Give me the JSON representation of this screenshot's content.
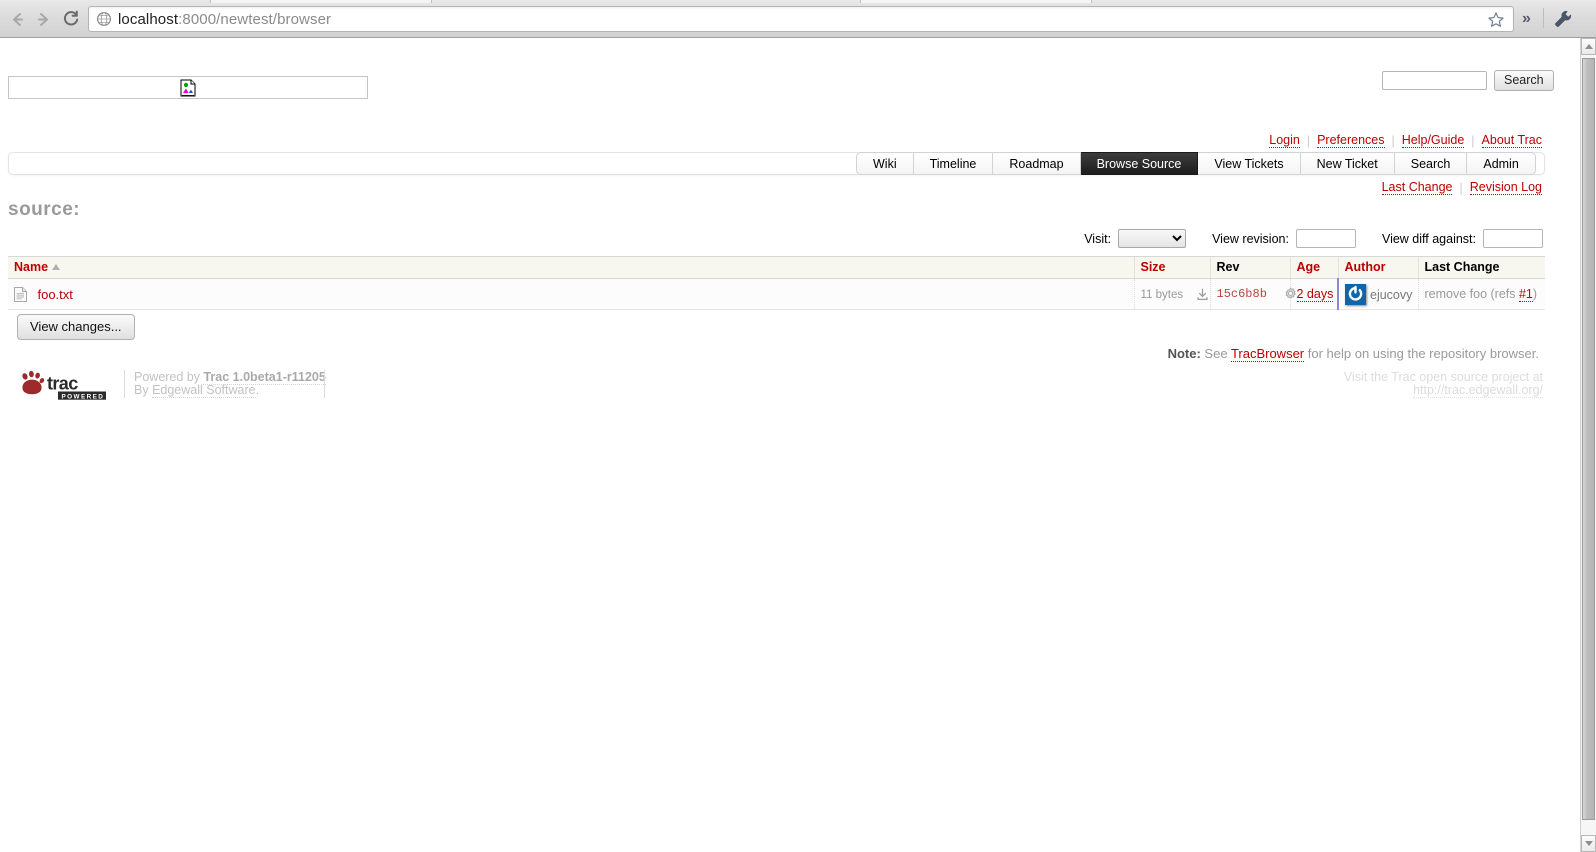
{
  "browser": {
    "back_icon": "arrow-left-icon",
    "forward_icon": "arrow-right-icon",
    "reload_icon": "reload-icon",
    "page_icon": "globe-icon",
    "url_host": "localhost",
    "url_rest": ":8000/newtest/browser",
    "star_icon": "bookmark-star-icon",
    "overflow_label": "»",
    "menu_icon": "wrench-icon"
  },
  "banner": {
    "logo_alt": "broken-image-icon",
    "search": {
      "value": "",
      "placeholder": "",
      "button_label": "Search"
    }
  },
  "metanav": {
    "items": [
      {
        "label": "Login"
      },
      {
        "label": "Preferences"
      },
      {
        "label": "Help/Guide"
      },
      {
        "label": "About Trac"
      }
    ],
    "separator": "|"
  },
  "mainnav": {
    "tabs": [
      {
        "label": "Wiki",
        "active": false
      },
      {
        "label": "Timeline",
        "active": false
      },
      {
        "label": "Roadmap",
        "active": false
      },
      {
        "label": "Browse Source",
        "active": true
      },
      {
        "label": "View Tickets",
        "active": false
      },
      {
        "label": "New Ticket",
        "active": false
      },
      {
        "label": "Search",
        "active": false
      },
      {
        "label": "Admin",
        "active": false
      }
    ]
  },
  "ctxnav": {
    "items": [
      {
        "label": "Last Change"
      },
      {
        "label": "Revision Log"
      }
    ],
    "separator": "|"
  },
  "page": {
    "title": "source:"
  },
  "rev_controls": {
    "visit_label": "Visit:",
    "visit_value": "",
    "view_revision_label": "View revision:",
    "view_revision_value": "",
    "view_diff_label": "View diff against:",
    "view_diff_value": ""
  },
  "dirlist": {
    "columns": [
      {
        "key": "name",
        "label": "Name",
        "sortable": true,
        "sorted": "asc"
      },
      {
        "key": "size",
        "label": "Size",
        "sortable": true
      },
      {
        "key": "rev",
        "label": "Rev",
        "sortable": false
      },
      {
        "key": "age",
        "label": "Age",
        "sortable": true
      },
      {
        "key": "author",
        "label": "Author",
        "sortable": true
      },
      {
        "key": "change",
        "label": "Last Change",
        "sortable": false
      }
    ],
    "rows": [
      {
        "icon": "text-file-icon",
        "name": "foo.txt",
        "size": "11 bytes",
        "download_icon": "download-icon",
        "rev": "15c6b8b",
        "rev_icon": "cog-icon",
        "age": "2 days",
        "author_avatar": "gravatar-avatar",
        "author": "ejucovy",
        "change_text_before": "remove foo (refs ",
        "change_ticket": "#1",
        "change_text_after": ")"
      }
    ]
  },
  "actions": {
    "view_changes_label": "View changes..."
  },
  "note": {
    "prefix": "Note:",
    "text_before": " See ",
    "link": "TracBrowser",
    "text_after": " for help on using the repository browser."
  },
  "footer": {
    "logo_text": "trac",
    "logo_badge": "POWERED",
    "powered_by_prefix": "Powered by ",
    "powered_by_product": "Trac 1.0beta1-r11205",
    "by_prefix": "By ",
    "by_company": "Edgewall Software",
    "by_suffix": ".",
    "visit_line1": "Visit the Trac open source project at",
    "visit_line2": "http://trac.edgewall.org/"
  },
  "scrollbar": {
    "up_icon": "scroll-up-arrow-icon",
    "down_icon": "scroll-down-arrow-icon"
  },
  "colors": {
    "trac_red": "#bb0000",
    "active_tab_bg": "#1d1d1d",
    "avatar_blue": "#1065a8"
  }
}
